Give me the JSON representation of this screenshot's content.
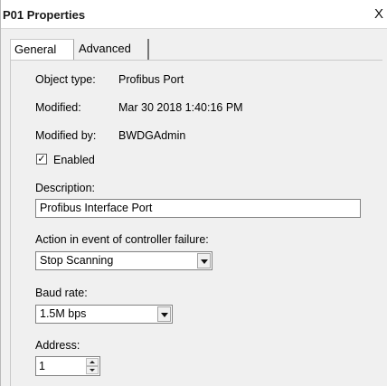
{
  "window": {
    "title": "P01 Properties",
    "close_glyph": "X"
  },
  "tabs": [
    {
      "label": "General",
      "active": true
    },
    {
      "label": "Advanced",
      "active": false
    }
  ],
  "general": {
    "object_type_label": "Object type:",
    "object_type_value": "Profibus Port",
    "modified_label": "Modified:",
    "modified_value": "Mar 30 2018 1:40:16 PM",
    "modified_by_label": "Modified by:",
    "modified_by_value": "BWDGAdmin",
    "enabled_label": "Enabled",
    "enabled_checked": true,
    "check_glyph": "✓",
    "description_label": "Description:",
    "description_value": "Profibus Interface Port",
    "controller_failure_label": "Action in event of controller failure:",
    "controller_failure_value": "Stop Scanning",
    "baud_rate_label": "Baud rate:",
    "baud_rate_value": "1.5M bps",
    "address_label": "Address:",
    "address_value": "1"
  },
  "icons": {
    "close": "close-icon",
    "dropdown": "chevron-down-icon",
    "spin_up": "spin-up-icon",
    "spin_down": "spin-down-icon",
    "checkmark": "checkmark-icon"
  }
}
